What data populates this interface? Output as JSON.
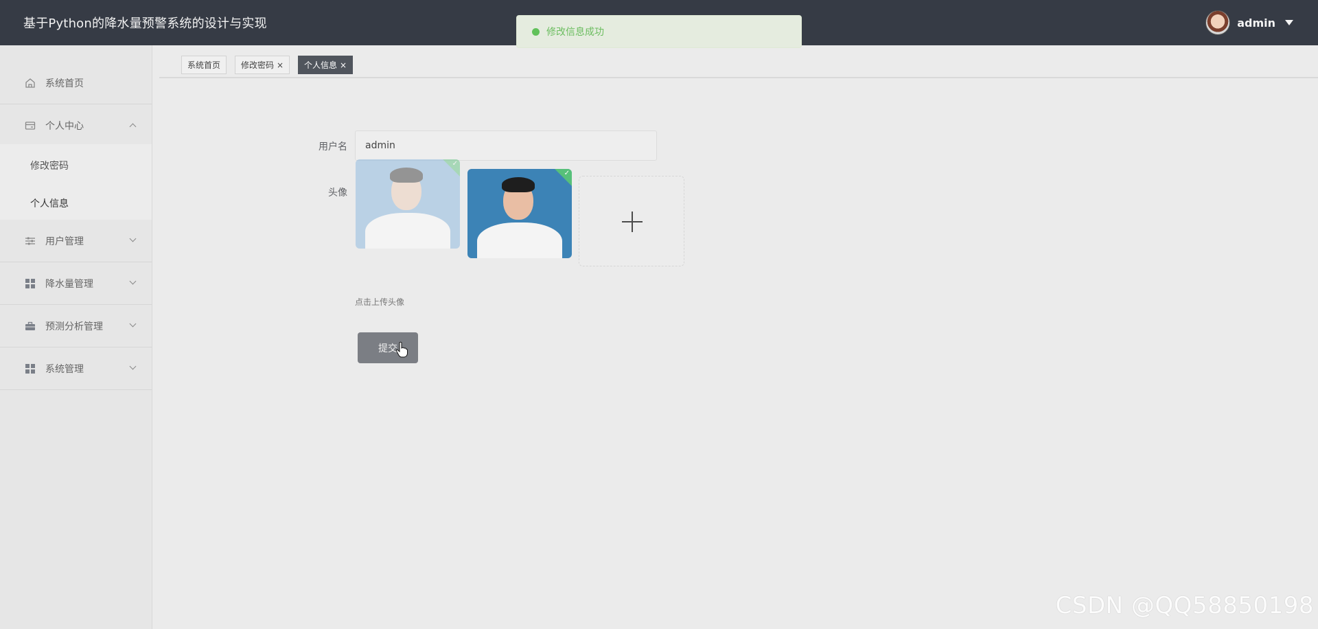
{
  "app": {
    "title": "基于Python的降水量预警系统的设计与实现"
  },
  "user": {
    "name": "admin"
  },
  "toast": {
    "message": "修改信息成功",
    "color": "#67c23a"
  },
  "sidebar": {
    "items": [
      {
        "label": "系统首页",
        "icon": "home-icon"
      },
      {
        "label": "个人中心",
        "icon": "card-icon",
        "expanded": true
      },
      {
        "label": "用户管理",
        "icon": "sliders-icon"
      },
      {
        "label": "降水量管理",
        "icon": "grid-icon"
      },
      {
        "label": "预测分析管理",
        "icon": "briefcase-icon"
      },
      {
        "label": "系统管理",
        "icon": "grid-icon"
      }
    ],
    "subitems": [
      {
        "label": "修改密码"
      },
      {
        "label": "个人信息"
      }
    ]
  },
  "tabs": [
    {
      "label": "系统首页",
      "closable": false,
      "active": false
    },
    {
      "label": "修改密码",
      "closable": true,
      "active": false
    },
    {
      "label": "个人信息",
      "closable": true,
      "active": true
    }
  ],
  "tab_close_glyph": "×",
  "form": {
    "username_label": "用户名",
    "username_value": "admin",
    "avatar_label": "头像",
    "upload_hint": "点击上传头像",
    "submit_label": "提交"
  },
  "watermark": "CSDN @QQ58850198"
}
